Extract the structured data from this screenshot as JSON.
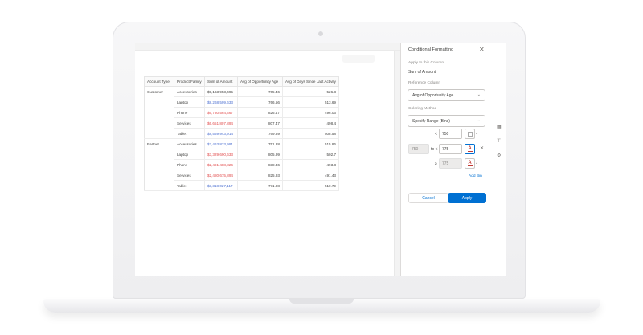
{
  "report": {
    "headers": [
      "Account Type",
      "Product Family",
      "Sum of Amount",
      "Avg of Opportunity Age",
      "Avg of Days Since Last Activity"
    ],
    "groups": [
      {
        "account_type": "Customer",
        "rows": [
          {
            "family": "Accessories",
            "amount": "$9,163,953,495",
            "opp_age": "705.46",
            "days": "526.8",
            "amount_color": "#3e3e3c"
          },
          {
            "family": "Laptop",
            "amount": "$8,268,599,633",
            "opp_age": "766.56",
            "days": "513.69",
            "amount_color": "#4b6fd0"
          },
          {
            "family": "Phone",
            "amount": "$6,730,564,467",
            "opp_age": "826.47",
            "days": "496.06",
            "amount_color": "#e14a4a"
          },
          {
            "family": "Services",
            "amount": "$6,651,807,894",
            "opp_age": "807.47",
            "days": "498.4",
            "amount_color": "#e14a4a"
          },
          {
            "family": "Tablet",
            "amount": "$8,559,943,914",
            "opp_age": "769.89",
            "days": "508.58",
            "amount_color": "#4b6fd0"
          }
        ]
      },
      {
        "account_type": "Partner",
        "rows": [
          {
            "family": "Accessories",
            "amount": "$3,463,833,991",
            "opp_age": "751.28",
            "days": "515.86",
            "amount_color": "#4b6fd0"
          },
          {
            "family": "Laptop",
            "amount": "$3,329,690,633",
            "opp_age": "805.99",
            "days": "502.7",
            "amount_color": "#e14a4a"
          },
          {
            "family": "Phone",
            "amount": "$2,491,488,826",
            "opp_age": "838.36",
            "days": "493.8",
            "amount_color": "#e14a4a"
          },
          {
            "family": "Services",
            "amount": "$2,480,675,894",
            "opp_age": "825.93",
            "days": "491.43",
            "amount_color": "#e14a4a"
          },
          {
            "family": "Tablet",
            "amount": "$3,318,027,117",
            "opp_age": "771.98",
            "days": "510.79",
            "amount_color": "#4b6fd0"
          }
        ]
      }
    ]
  },
  "panel": {
    "title": "Conditional Formatting",
    "close_icon": "close-icon",
    "apply_to_label": "Apply to this Column",
    "apply_to_value": "Sum of Amount",
    "reference_label": "Reference Column",
    "reference_value": "Avg of Opportunity Age",
    "coloring_label": "Coloring Method",
    "coloring_value": "Specify Range (Bins)",
    "bins": {
      "row1_op": "<",
      "row1_value": "750",
      "row2_from": "750",
      "row2_to_label": "to <",
      "row2_value": "775",
      "row3_op": "≥",
      "row3_value": "775",
      "font_icon": "A"
    },
    "add_bin": "Add Bin",
    "cancel": "Cancel",
    "apply": "Apply"
  },
  "colors": {
    "brand": "#0070d2",
    "high": "#4b6fd0",
    "low": "#e14a4a"
  }
}
